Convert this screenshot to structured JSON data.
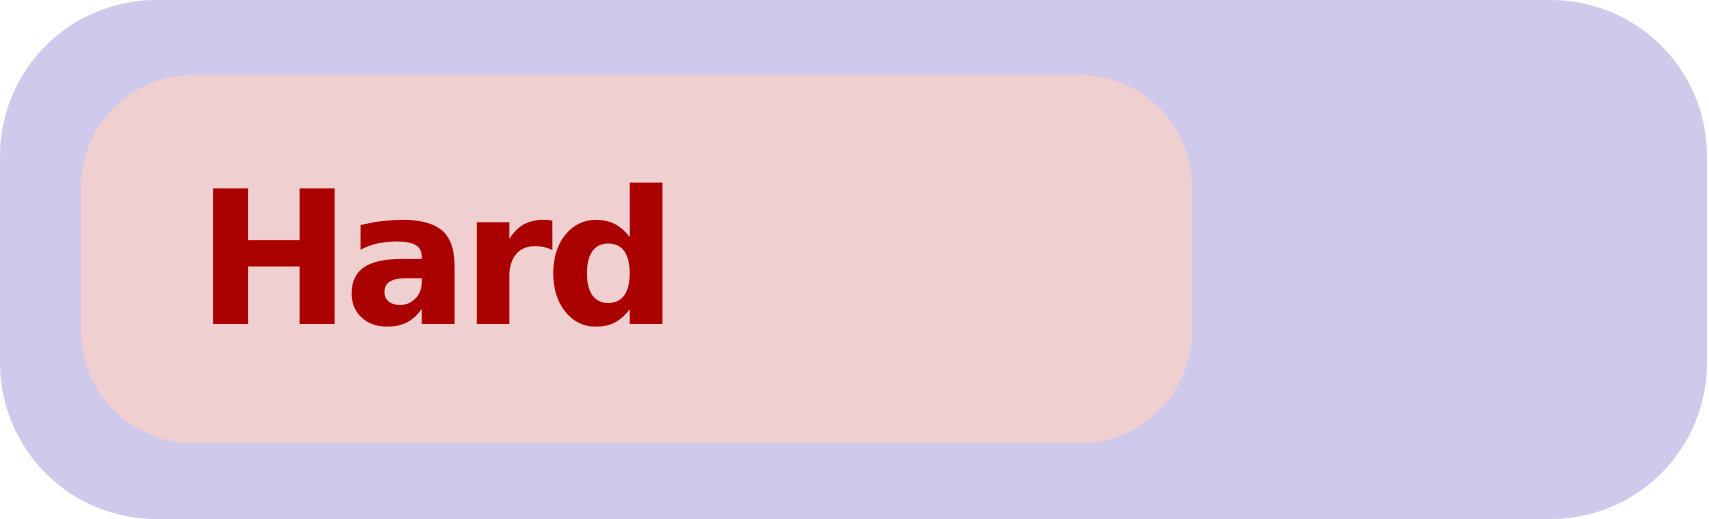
{
  "badge": {
    "label": "Hard"
  },
  "colors": {
    "outer_background": "#cfcaeb",
    "badge_background": "#f0cfd1",
    "label_text": "#aa0000"
  }
}
